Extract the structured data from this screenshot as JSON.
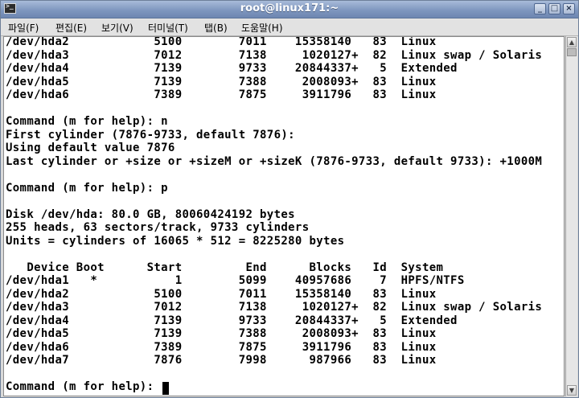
{
  "window": {
    "title": "root@linux171:~",
    "buttons": {
      "minimize": "_",
      "maximize": "□",
      "close": "×"
    }
  },
  "menu": [
    "파일(F)",
    "편집(E)",
    "보기(V)",
    "터미널(T)",
    "탭(B)",
    "도움말(H)"
  ],
  "terminal": {
    "lines": [
      "/dev/hda2            5100        7011    15358140   83  Linux",
      "/dev/hda3            7012        7138     1020127+  82  Linux swap / Solaris",
      "/dev/hda4            7139        9733    20844337+   5  Extended",
      "/dev/hda5            7139        7388     2008093+  83  Linux",
      "/dev/hda6            7389        7875     3911796   83  Linux",
      "",
      "Command (m for help): n",
      "First cylinder (7876-9733, default 7876):",
      "Using default value 7876",
      "Last cylinder or +size or +sizeM or +sizeK (7876-9733, default 9733): +1000M",
      "",
      "Command (m for help): p",
      "",
      "Disk /dev/hda: 80.0 GB, 80060424192 bytes",
      "255 heads, 63 sectors/track, 9733 cylinders",
      "Units = cylinders of 16065 * 512 = 8225280 bytes",
      "",
      "   Device Boot      Start         End      Blocks   Id  System",
      "/dev/hda1   *           1        5099    40957686    7  HPFS/NTFS",
      "/dev/hda2            5100        7011    15358140   83  Linux",
      "/dev/hda3            7012        7138     1020127+  82  Linux swap / Solaris",
      "/dev/hda4            7139        9733    20844337+   5  Extended",
      "/dev/hda5            7139        7388     2008093+  83  Linux",
      "/dev/hda6            7389        7875     3911796   83  Linux",
      "/dev/hda7            7876        7998      987966   83  Linux",
      "",
      "Command (m for help): "
    ]
  }
}
